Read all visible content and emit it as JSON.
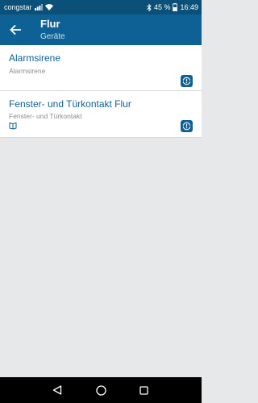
{
  "status_bar": {
    "carrier": "congstar",
    "battery_percent": "45 %",
    "time": "16:49"
  },
  "header": {
    "title": "Flur",
    "subtitle": "Geräte"
  },
  "devices": [
    {
      "name": "Alarmsirene",
      "type": "Alarmsirene",
      "has_book_icon": false,
      "badge_icon": "alert-warning-icon"
    },
    {
      "name": "Fenster- und Türkontakt Flur",
      "type": "Fenster- und Türkontakt",
      "has_book_icon": true,
      "badge_icon": "alert-warning-icon"
    }
  ],
  "colors": {
    "status_bar": "#0a5078",
    "app_bar": "#0e6194",
    "accent": "#0e6194",
    "background": "#e6e8e9",
    "card": "#ffffff",
    "secondary_text": "#8c8c8c"
  },
  "nav": {
    "icons": [
      "back-triangle-icon",
      "home-circle-icon",
      "recents-square-icon"
    ]
  }
}
